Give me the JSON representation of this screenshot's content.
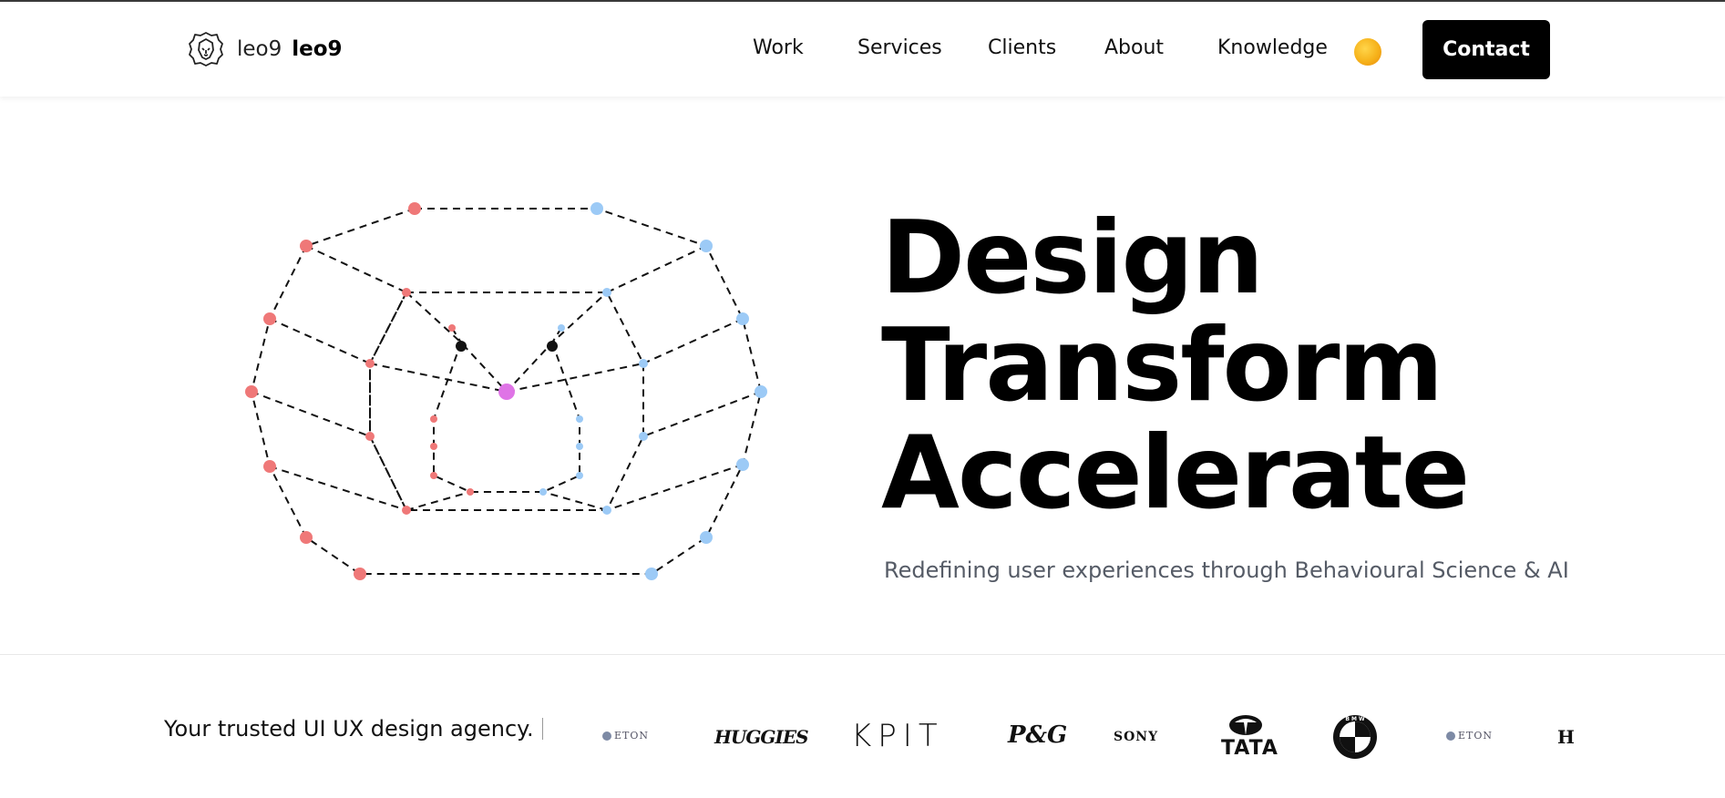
{
  "header": {
    "brand_text": "leo9",
    "brand_bold": "leo9",
    "nav": [
      {
        "label": "Work"
      },
      {
        "label": "Services"
      },
      {
        "label": "Clients"
      },
      {
        "label": "About"
      },
      {
        "label": "Knowledge"
      }
    ],
    "contact_label": "Contact"
  },
  "hero": {
    "title_lines": [
      "Design",
      "Transform",
      "Accelerate"
    ],
    "subtitle": "Redefining user experiences through Behavioural Science & AI"
  },
  "clients": {
    "tagline": "Your trusted UI UX design agency.",
    "logos": [
      {
        "name": "eton",
        "text": "ETON"
      },
      {
        "name": "huggies",
        "text": "HUGGIES"
      },
      {
        "name": "kpit",
        "text": "KPIT"
      },
      {
        "name": "pg",
        "text": "P&G"
      },
      {
        "name": "sony",
        "text": "SONY"
      },
      {
        "name": "tata",
        "text": "TATA"
      },
      {
        "name": "bmw",
        "text": "B M W"
      },
      {
        "name": "eton-2",
        "text": "ETON"
      },
      {
        "name": "h",
        "text": "H"
      }
    ]
  },
  "colors": {
    "accent_red": "#ef7878",
    "accent_blue": "#9ccaf6",
    "accent_magenta": "#df74e6",
    "button_bg": "#000000",
    "subtitle": "#555b66"
  }
}
